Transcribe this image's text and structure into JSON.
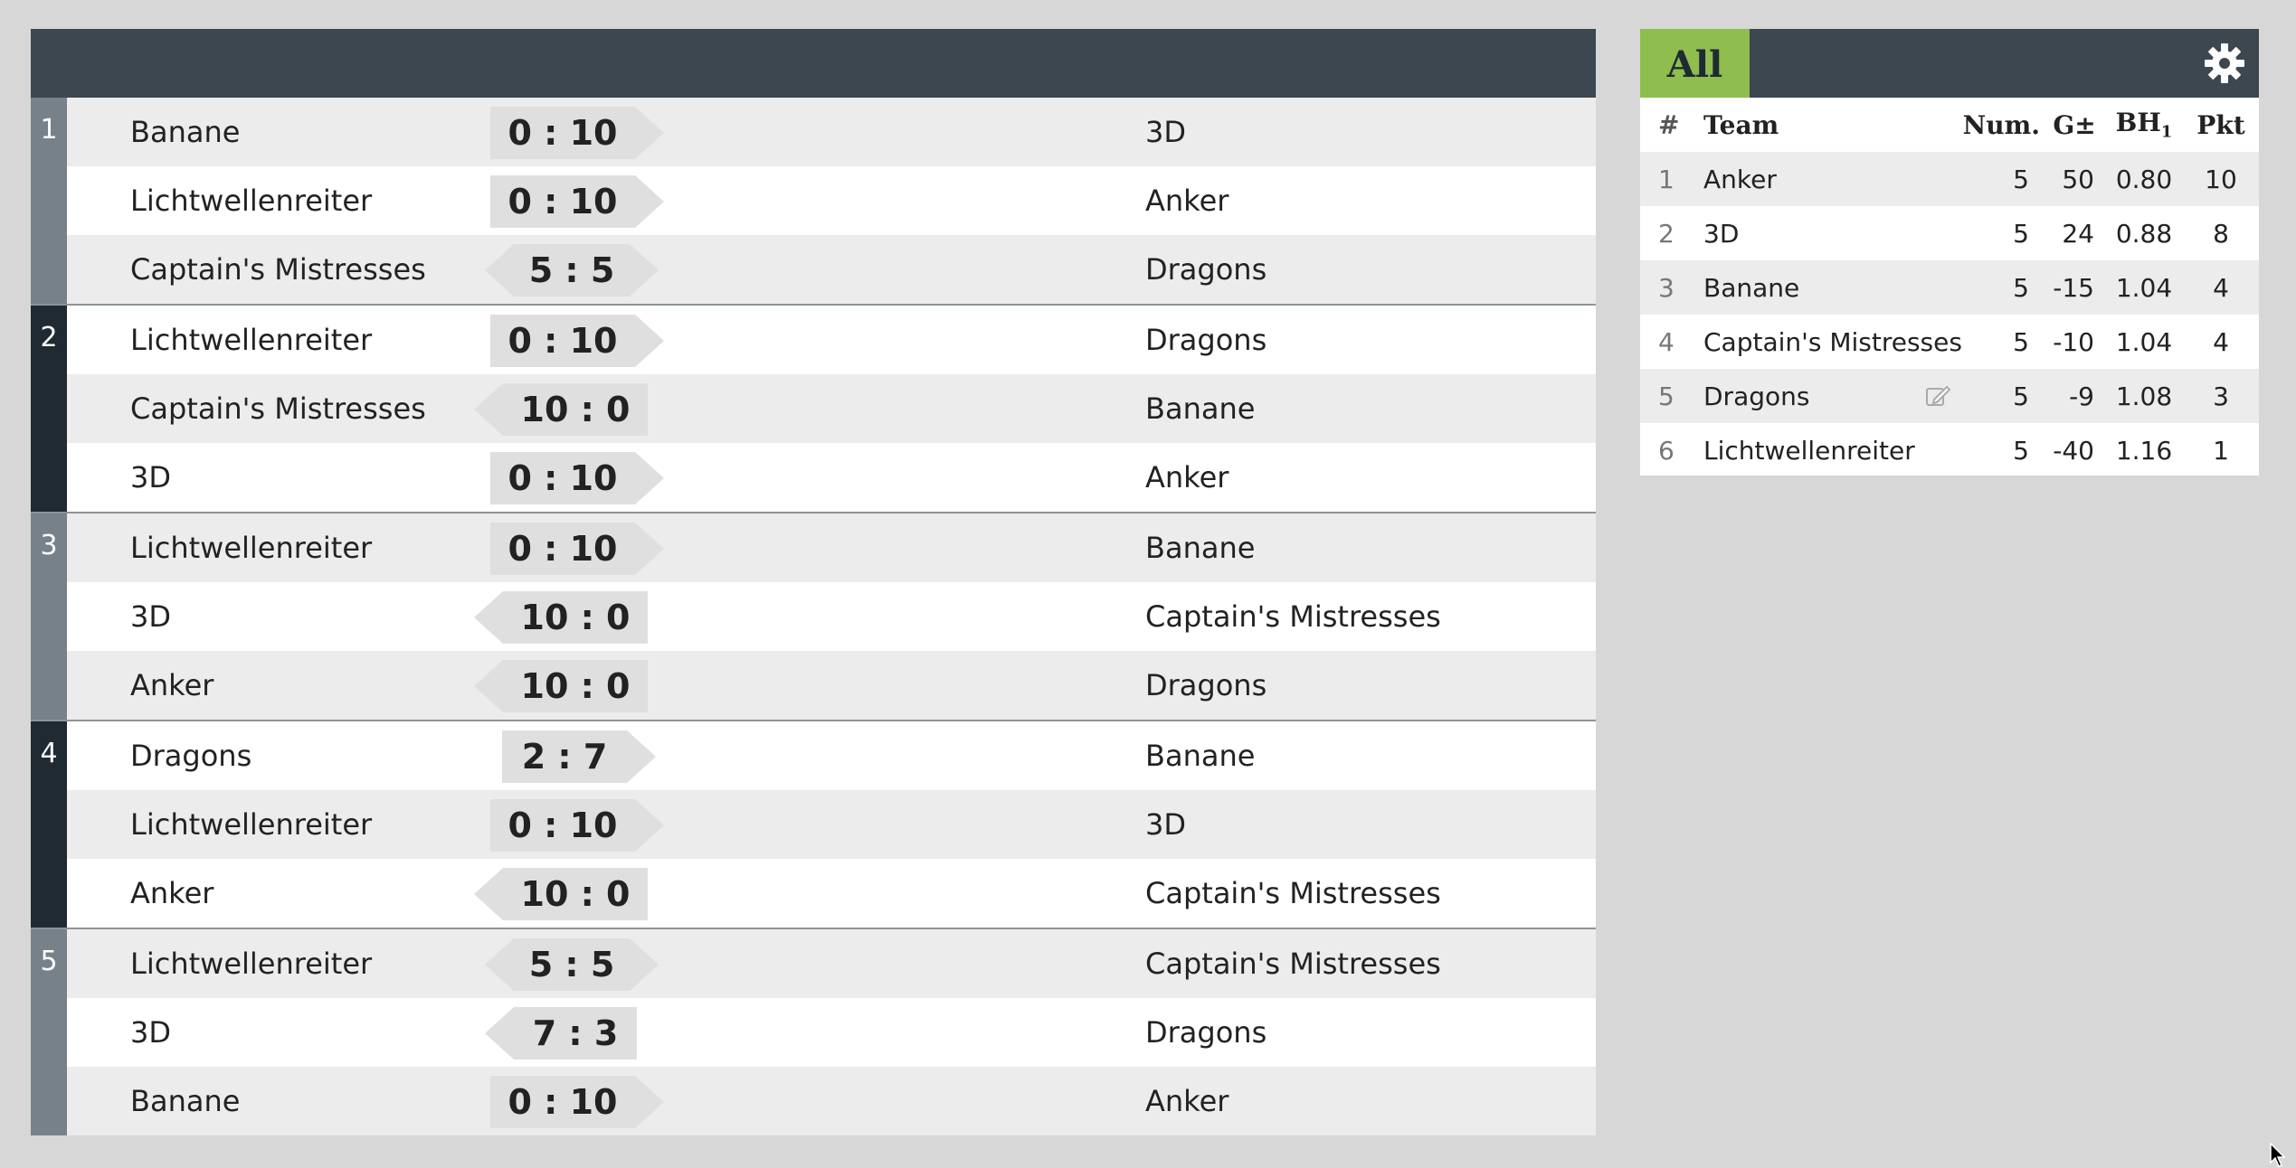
{
  "rounds": [
    {
      "number": "1",
      "games": [
        {
          "home": "Banane",
          "score": "0 : 10",
          "away": "3D",
          "dir": "right"
        },
        {
          "home": "Lichtwellenreiter",
          "score": "0 : 10",
          "away": "Anker",
          "dir": "right"
        },
        {
          "home": "Captain's Mistresses",
          "score": "5 : 5",
          "away": "Dragons",
          "dir": "both"
        }
      ]
    },
    {
      "number": "2",
      "games": [
        {
          "home": "Lichtwellenreiter",
          "score": "0 : 10",
          "away": "Dragons",
          "dir": "right"
        },
        {
          "home": "Captain's Mistresses",
          "score": "10 : 0",
          "away": "Banane",
          "dir": "left"
        },
        {
          "home": "3D",
          "score": "0 : 10",
          "away": "Anker",
          "dir": "right"
        }
      ]
    },
    {
      "number": "3",
      "games": [
        {
          "home": "Lichtwellenreiter",
          "score": "0 : 10",
          "away": "Banane",
          "dir": "right"
        },
        {
          "home": "3D",
          "score": "10 : 0",
          "away": "Captain's Mistresses",
          "dir": "left"
        },
        {
          "home": "Anker",
          "score": "10 : 0",
          "away": "Dragons",
          "dir": "left"
        }
      ]
    },
    {
      "number": "4",
      "games": [
        {
          "home": "Dragons",
          "score": "2 : 7",
          "away": "Banane",
          "dir": "right"
        },
        {
          "home": "Lichtwellenreiter",
          "score": "0 : 10",
          "away": "3D",
          "dir": "right"
        },
        {
          "home": "Anker",
          "score": "10 : 0",
          "away": "Captain's Mistresses",
          "dir": "left"
        }
      ]
    },
    {
      "number": "5",
      "games": [
        {
          "home": "Lichtwellenreiter",
          "score": "5 : 5",
          "away": "Captain's Mistresses",
          "dir": "both"
        },
        {
          "home": "3D",
          "score": "7 : 3",
          "away": "Dragons",
          "dir": "left"
        },
        {
          "home": "Banane",
          "score": "0 : 10",
          "away": "Anker",
          "dir": "right"
        }
      ]
    }
  ],
  "standings": {
    "tab_label": "All",
    "columns": {
      "rank": "#",
      "team": "Team",
      "num": "Num.",
      "g": "G±",
      "bh": "BH",
      "bh_sub": "1",
      "pkt": "Pkt"
    },
    "rows": [
      {
        "rank": "1",
        "team": "Anker",
        "num": "5",
        "g": "50",
        "bh": "0.80",
        "pkt": "10"
      },
      {
        "rank": "2",
        "team": "3D",
        "num": "5",
        "g": "24",
        "bh": "0.88",
        "pkt": "8"
      },
      {
        "rank": "3",
        "team": "Banane",
        "num": "5",
        "g": "-15",
        "bh": "1.04",
        "pkt": "4"
      },
      {
        "rank": "4",
        "team": "Captain's Mistresses",
        "num": "5",
        "g": "-10",
        "bh": "1.04",
        "pkt": "4"
      },
      {
        "rank": "5",
        "team": "Dragons",
        "num": "5",
        "g": "-9",
        "bh": "1.08",
        "pkt": "3",
        "editable": true
      },
      {
        "rank": "6",
        "team": "Lichtwellenreiter",
        "num": "5",
        "g": "-40",
        "bh": "1.16",
        "pkt": "1"
      }
    ]
  },
  "icons": {
    "settings": "gear-icon",
    "edit": "edit-icon"
  },
  "colors": {
    "header": "#3c4750",
    "accent": "#8fbd4e",
    "round_light": "#77818a",
    "round_dark": "#1f2a32"
  }
}
